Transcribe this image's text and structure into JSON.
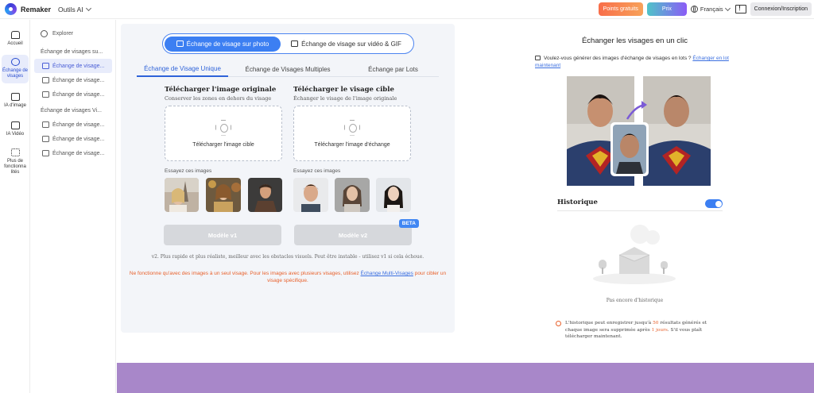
{
  "topbar": {
    "brand": "Remaker",
    "tools_label": "Outils AI",
    "free_points": "Points gratuits",
    "price": "Prix",
    "language": "Français",
    "login": "Connexion/Inscription"
  },
  "rail": {
    "items": [
      {
        "label": "Accueil",
        "icon": "home-icon"
      },
      {
        "label": "Échange de visages",
        "icon": "face-swap-icon"
      },
      {
        "label": "IA d'image",
        "icon": "image-ai-icon"
      },
      {
        "label": "IA Vidéo",
        "icon": "video-ai-icon"
      },
      {
        "label": "Plus de fonctionna lités",
        "icon": "more-features-icon"
      }
    ]
  },
  "subnav": {
    "explore": "Explorer",
    "group1": "Échange de visages su...",
    "group1_items": [
      "Échange de visage...",
      "Échange de visage...",
      "Échange de visage..."
    ],
    "group2": "Échange de visages Vi...",
    "group2_items": [
      "Échange de visage...",
      "Échange de visage...",
      "Échange de visage..."
    ]
  },
  "main": {
    "mode_photo": "Échange de visage sur photo",
    "mode_video": "Échange de visage sur vidéo & GIF",
    "tabs": [
      "Échange de Visage Unique",
      "Échange de Visages Multiples",
      "Échange par Lots"
    ],
    "original": {
      "title": "Télécharger l'image originale",
      "subtitle": "Conserver les zones en dehors du visage",
      "drop_label": "Télécharger l'image cible",
      "try_label": "Essayez ces images"
    },
    "target": {
      "title": "Télécharger le visage cible",
      "subtitle": "Échanger le visage de l'image originale",
      "drop_label": "Télécharger l'image d'échange",
      "try_label": "Essayez ces images"
    },
    "model_v1": "Modèle v1",
    "model_v2": "Modèle v2",
    "beta": "BETA",
    "v2_note": "v2. Plus rapide et plus réaliste, meilleur avec les obstacles visuels. Peut être instable - utilisez v1 si cela échoue.",
    "warning_pre": "Ne fonctionne qu'avec des images à un seul visage. Pour les images avec plusieurs visages, utilisez ",
    "warning_link": "Échange Multi-Visages",
    "warning_post": " pour cibler un visage spécifique."
  },
  "right": {
    "title": "Échanger les visages en un clic",
    "promo_text": "Voulez-vous générer des images d'échange de visages en lots ?",
    "promo_link": "Échanger en lot maintenant",
    "history_title": "Historique",
    "history_enabled": true,
    "empty": "Pas encore d'historique",
    "info_1": "L'historique peut enregistrer jusqu'à ",
    "info_count": "50",
    "info_2": " résultats générés et chaque image sera supprimée après ",
    "info_days": "1 jours",
    "info_3": ". S'il vous plaît télécharger maintenant."
  },
  "colors": {
    "accent": "#3c7ff2",
    "warning": "#e8612c",
    "footer": "#a887c9"
  }
}
